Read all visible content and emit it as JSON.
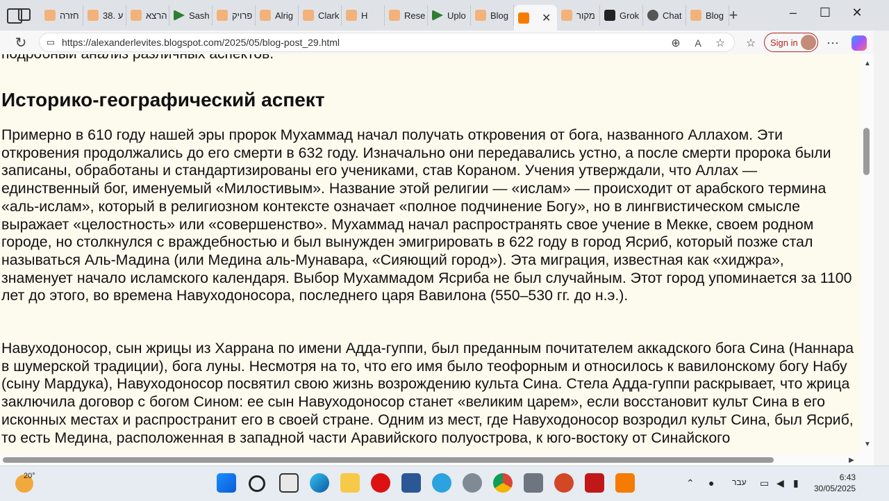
{
  "tabs": [
    {
      "label": "חזרה",
      "icon": "blogger-icon"
    },
    {
      "label": "38. ע",
      "icon": "blogger-icon"
    },
    {
      "label": "הרצא",
      "icon": "blogger-icon"
    },
    {
      "label": "Sash",
      "icon": "upload-icon"
    },
    {
      "label": "פרויק",
      "icon": "blogger-icon"
    },
    {
      "label": "Alrig",
      "icon": "blogger-icon"
    },
    {
      "label": "Clark",
      "icon": "blogger-icon"
    },
    {
      "label": "H",
      "icon": "blogger-icon"
    },
    {
      "label": "Rese",
      "icon": "blogger-icon"
    },
    {
      "label": "Uplo",
      "icon": "upload-icon"
    },
    {
      "label": "Blog",
      "icon": "blogger-icon"
    },
    {
      "label": "",
      "icon": "blogger-icon",
      "active": true
    },
    {
      "label": "מקור",
      "icon": "blogger-icon"
    },
    {
      "label": "Grok",
      "icon": "grok-icon"
    },
    {
      "label": "Chat",
      "icon": "chatgpt-icon"
    },
    {
      "label": "Blog",
      "icon": "blogger-icon"
    }
  ],
  "address_bar": {
    "url": "https://alexanderlevites.blogspot.com/2025/05/blog-post_29.html",
    "sign_in": "Sign in"
  },
  "article": {
    "cut_line": "подробный анализ различных аспектов.",
    "heading": "Историко-географический аспект",
    "para1": "Примерно в 610 году нашей эры пророк Мухаммад начал получать откровения от бога, названного Аллахом. Эти откровения продолжались до его смерти в 632 году. Изначально они передавались устно, а после смерти пророка были записаны, обработаны и стандартизированы его учениками, став Кораном. Учения утверждали, что Аллах — единственный бог, именуемый «Милостивым». Название этой религии — «ислам» — происходит от арабского термина «аль-ислам», который в религиозном контексте означает «полное подчинение Богу», но в лингвистическом смысле выражает «целостность» или «совершенство». Мухаммад начал распространять свое учение в Мекке, своем родном городе, но столкнулся с враждебностью и был вынужден эмигрировать в 622 году в город Ясриб, который позже стал называться Аль-Мадина (или Медина аль-Мунавара, «Сияющий город»). Эта миграция, известная как «хиджра», знаменует начало исламского календаря. Выбор Мухаммадом Ясриба не был случайным. Этот город упоминается за 1100 лет до этого, во времена Навуходоносора, последнего царя Вавилона (550–530 гг. до н.э.).",
    "para2": "Навуходоносор, сын жрицы из Харрана по имени Адда-гуппи, был преданным почитателем аккадского бога Сина (Наннара в шумерской традиции), бога луны. Несмотря на то, что его имя было теофорным и относилось к вавилонскому богу Набу (сыну Мардука), Навуходоносор посвятил свою жизнь возрождению культа Сина. Стела Адда-гуппи раскрывает, что жрица заключила договор с богом Сином: ее сын Навуходоносор станет «великим царем», если восстановит культ Сина в его исконных местах и распространит его в своей стране. Одним из мест, где Навуходоносор возродил культ Сина, был Ясриб, то есть Медина, расположенная в западной части Аравийского полуострова, к юго-востоку от Синайского"
  },
  "taskbar": {
    "weather_temp": "20°",
    "language": "עבר",
    "time": "6:43",
    "date": "30/05/2025"
  }
}
